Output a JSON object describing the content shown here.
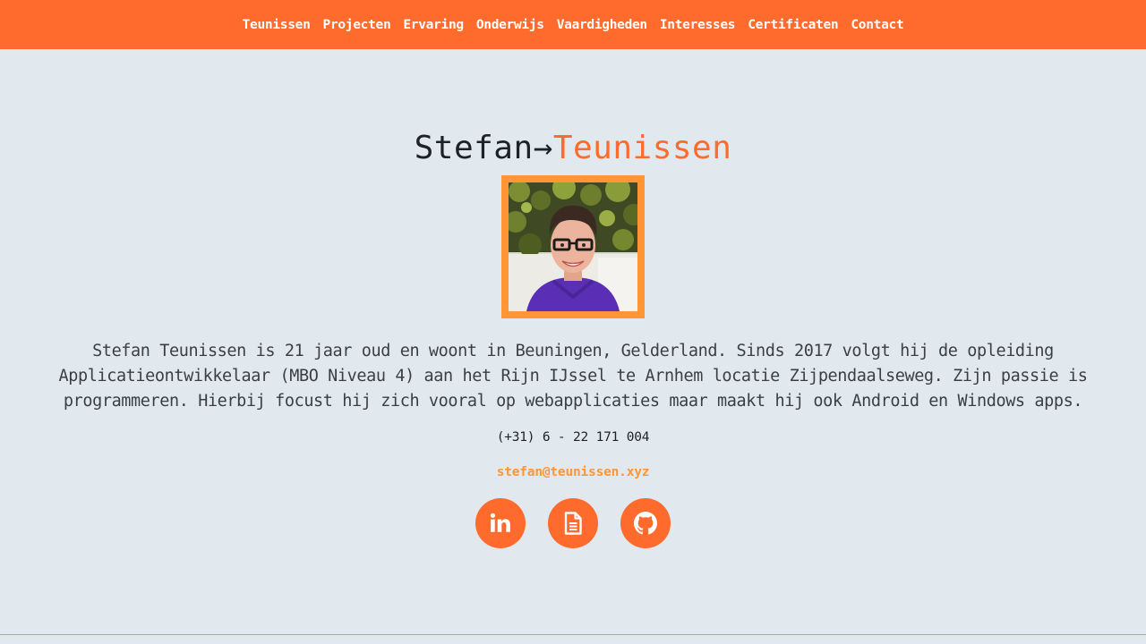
{
  "nav": {
    "items": [
      {
        "label": "Teunissen"
      },
      {
        "label": "Projecten"
      },
      {
        "label": "Ervaring"
      },
      {
        "label": "Onderwijs"
      },
      {
        "label": "Vaardigheden"
      },
      {
        "label": "Interesses"
      },
      {
        "label": "Certificaten"
      },
      {
        "label": "Contact"
      }
    ]
  },
  "hero": {
    "first_name": "Stefan",
    "arrow": "→",
    "last_name": "Teunissen",
    "bio": "Stefan Teunissen is 21 jaar oud en woont in Beuningen, Gelderland. Sinds 2017 volgt hij de opleiding Applicatieontwikkelaar (MBO Niveau 4) aan het Rijn IJssel te Arnhem locatie Zijpendaalseweg. Zijn passie is programmeren. Hierbij focust hij zich vooral op webapplicaties maar maakt hij ook Android en Windows apps.",
    "phone": "(+31) 6 - 22 171 004",
    "email": "stefan@teunissen.xyz"
  },
  "socials": [
    {
      "icon": "linkedin-icon"
    },
    {
      "icon": "document-icon"
    },
    {
      "icon": "github-icon"
    }
  ],
  "colors": {
    "accent": "#ff6b2c",
    "accent_light": "#ff9535",
    "background": "#e1e9ef",
    "text": "#1c2226"
  }
}
